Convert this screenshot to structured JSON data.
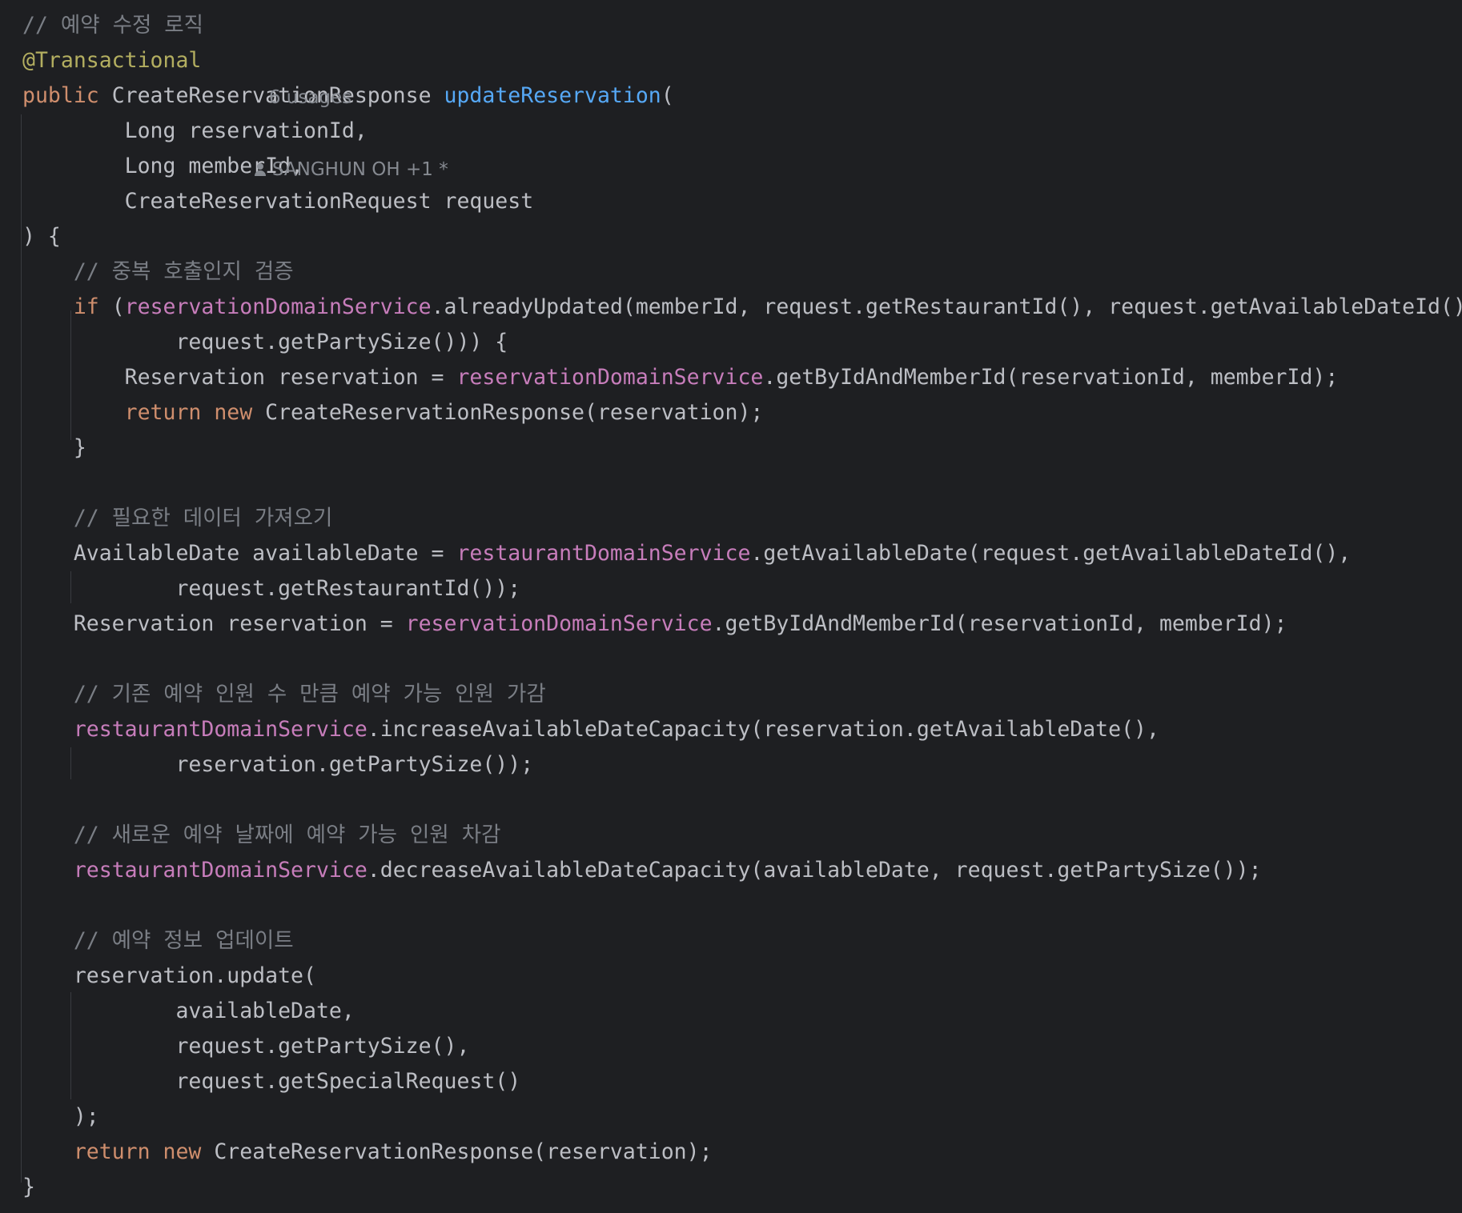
{
  "colors": {
    "background": "#1e1f22",
    "plain": "#bcbec4",
    "comment": "#7a7e85",
    "keyword": "#cf8e6d",
    "annotation": "#b3ae60",
    "method_declaration": "#56a8f5",
    "field": "#c77dbb",
    "inlay_hint": "#868a91"
  },
  "code": {
    "lines": [
      [
        {
          "t": "// 예약 수정 로직",
          "c": "comment"
        }
      ],
      [
        {
          "t": "@Transactional",
          "c": "annotation"
        }
      ],
      [
        {
          "t": "public ",
          "c": "keyword"
        },
        {
          "t": "CreateReservationResponse ",
          "c": "plain"
        },
        {
          "t": "updateReservation",
          "c": "method-decl"
        },
        {
          "t": "(",
          "c": "plain"
        }
      ],
      [
        {
          "t": "        Long reservationId,",
          "c": "plain"
        }
      ],
      [
        {
          "t": "        Long memberId,",
          "c": "plain"
        }
      ],
      [
        {
          "t": "        CreateReservationRequest request",
          "c": "plain"
        }
      ],
      [
        {
          "t": ") {",
          "c": "plain"
        }
      ],
      [
        {
          "t": "    // 중복 호출인지 검증",
          "c": "comment"
        }
      ],
      [
        {
          "t": "    ",
          "c": "plain"
        },
        {
          "t": "if",
          "c": "keyword"
        },
        {
          "t": " (",
          "c": "plain"
        },
        {
          "t": "reservationDomainService",
          "c": "field"
        },
        {
          "t": ".alreadyUpdated(memberId, request.getRestaurantId(), request.getAvailableDateId(),",
          "c": "plain"
        }
      ],
      [
        {
          "t": "            request.getPartySize())) {",
          "c": "plain"
        }
      ],
      [
        {
          "t": "        Reservation reservation = ",
          "c": "plain"
        },
        {
          "t": "reservationDomainService",
          "c": "field"
        },
        {
          "t": ".getByIdAndMemberId(reservationId, memberId);",
          "c": "plain"
        }
      ],
      [
        {
          "t": "        ",
          "c": "plain"
        },
        {
          "t": "return new ",
          "c": "keyword"
        },
        {
          "t": "CreateReservationResponse(reservation);",
          "c": "plain"
        }
      ],
      [
        {
          "t": "    }",
          "c": "plain"
        }
      ],
      [],
      [
        {
          "t": "    // 필요한 데이터 가져오기",
          "c": "comment"
        }
      ],
      [
        {
          "t": "    AvailableDate availableDate = ",
          "c": "plain"
        },
        {
          "t": "restaurantDomainService",
          "c": "field"
        },
        {
          "t": ".getAvailableDate(request.getAvailableDateId(),",
          "c": "plain"
        }
      ],
      [
        {
          "t": "            request.getRestaurantId());",
          "c": "plain"
        }
      ],
      [
        {
          "t": "    Reservation reservation = ",
          "c": "plain"
        },
        {
          "t": "reservationDomainService",
          "c": "field"
        },
        {
          "t": ".getByIdAndMemberId(reservationId, memberId);",
          "c": "plain"
        }
      ],
      [],
      [
        {
          "t": "    // 기존 예약 인원 수 만큼 예약 가능 인원 가감",
          "c": "comment"
        }
      ],
      [
        {
          "t": "    ",
          "c": "plain"
        },
        {
          "t": "restaurantDomainService",
          "c": "field"
        },
        {
          "t": ".increaseAvailableDateCapacity(reservation.getAvailableDate(),",
          "c": "plain"
        }
      ],
      [
        {
          "t": "            reservation.getPartySize());",
          "c": "plain"
        }
      ],
      [],
      [
        {
          "t": "    // 새로운 예약 날짜에 예약 가능 인원 차감",
          "c": "comment"
        }
      ],
      [
        {
          "t": "    ",
          "c": "plain"
        },
        {
          "t": "restaurantDomainService",
          "c": "field"
        },
        {
          "t": ".decreaseAvailableDateCapacity(availableDate, request.getPartySize());",
          "c": "plain"
        }
      ],
      [],
      [
        {
          "t": "    // 예약 정보 업데이트",
          "c": "comment"
        }
      ],
      [
        {
          "t": "    reservation.update(",
          "c": "plain"
        }
      ],
      [
        {
          "t": "            availableDate,",
          "c": "plain"
        }
      ],
      [
        {
          "t": "            request.getPartySize(),",
          "c": "plain"
        }
      ],
      [
        {
          "t": "            request.getSpecialRequest()",
          "c": "plain"
        }
      ],
      [
        {
          "t": "    );",
          "c": "plain"
        }
      ],
      [
        {
          "t": "    ",
          "c": "plain"
        },
        {
          "t": "return new ",
          "c": "keyword"
        },
        {
          "t": "CreateReservationResponse(reservation);",
          "c": "plain"
        }
      ],
      [
        {
          "t": "}",
          "c": "plain"
        }
      ]
    ]
  },
  "inlay_hints": {
    "usages": "6 usages",
    "author_icon": "user-icon",
    "author": "SANGHUN OH +1 *"
  }
}
